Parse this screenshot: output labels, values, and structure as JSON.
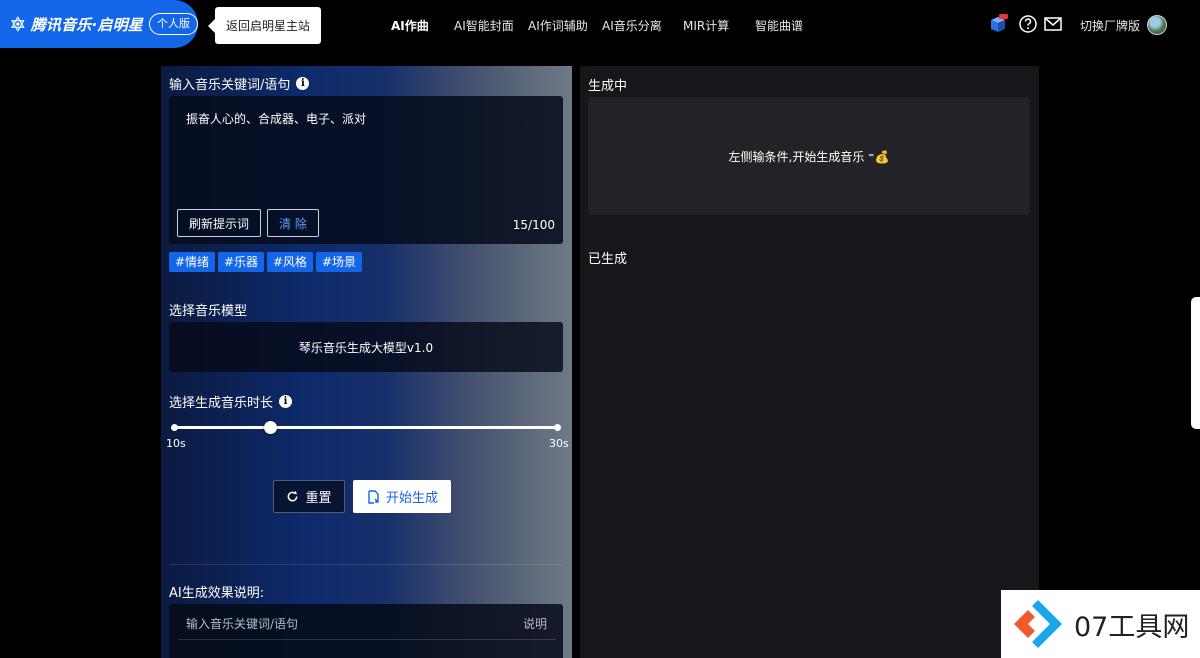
{
  "header": {
    "brand_name": "腾讯音乐·启明星",
    "brand_badge": "个人版",
    "back_link": "返回启明星主站",
    "nav": [
      {
        "label": "AI作曲",
        "active": true
      },
      {
        "label": "AI智能封面",
        "active": false
      },
      {
        "label": "AI作词辅助",
        "active": false
      },
      {
        "label": "AI音乐分离",
        "active": false
      },
      {
        "label": "MIR计算",
        "active": false
      },
      {
        "label": "智能曲谱",
        "active": false
      }
    ],
    "icons": [
      "gift-box-icon",
      "help-icon",
      "mail-icon"
    ],
    "gift_badge": "new",
    "switch_label": "切换厂牌版"
  },
  "left": {
    "keyword_title": "输入音乐关键词/语句",
    "prompt_text": "振奋人心的、合成器、电子、派对",
    "refresh_label": "刷新提示词",
    "clear_label": "清 除",
    "counter": "15/100",
    "tags": [
      "#情绪",
      "#乐器",
      "#风格",
      "#场景"
    ],
    "model_title": "选择音乐模型",
    "model_name": "琴乐音乐生成大模型v1.0",
    "duration_title": "选择生成音乐时长",
    "slider": {
      "min_label": "10s",
      "max_label": "30s",
      "min": 10,
      "max": 30,
      "value": 15
    },
    "reset_label": "重置",
    "start_label": "开始生成",
    "effect_title": "AI生成效果说明:",
    "table_headers": [
      "输入音乐关键词/语句",
      "说明"
    ]
  },
  "right": {
    "generating_title": "生成中",
    "generating_hint": "左侧输条件,开始生成音乐 ⁼💰",
    "generated_title": "已生成"
  },
  "watermark": {
    "text": "07工具网"
  },
  "colors": {
    "accent": "#1466e8",
    "panel_right": "#16171b",
    "box_dark": "#222327"
  }
}
